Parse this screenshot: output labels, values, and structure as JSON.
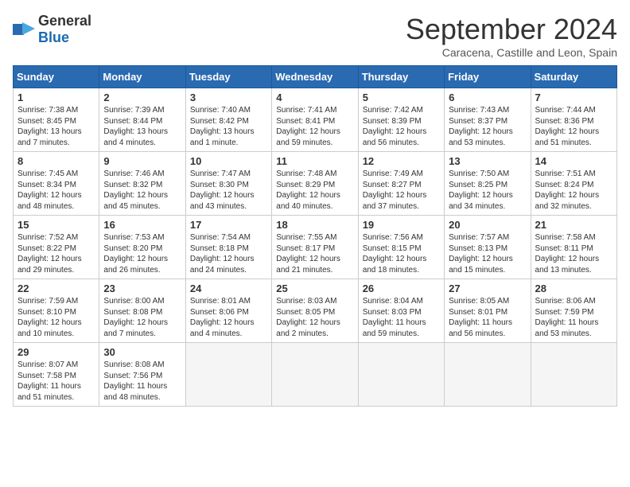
{
  "header": {
    "logo_general": "General",
    "logo_blue": "Blue",
    "title": "September 2024",
    "location": "Caracena, Castille and Leon, Spain"
  },
  "days_of_week": [
    "Sunday",
    "Monday",
    "Tuesday",
    "Wednesday",
    "Thursday",
    "Friday",
    "Saturday"
  ],
  "weeks": [
    [
      {
        "day": "1",
        "lines": [
          "Sunrise: 7:38 AM",
          "Sunset: 8:45 PM",
          "Daylight: 13 hours",
          "and 7 minutes."
        ]
      },
      {
        "day": "2",
        "lines": [
          "Sunrise: 7:39 AM",
          "Sunset: 8:44 PM",
          "Daylight: 13 hours",
          "and 4 minutes."
        ]
      },
      {
        "day": "3",
        "lines": [
          "Sunrise: 7:40 AM",
          "Sunset: 8:42 PM",
          "Daylight: 13 hours",
          "and 1 minute."
        ]
      },
      {
        "day": "4",
        "lines": [
          "Sunrise: 7:41 AM",
          "Sunset: 8:41 PM",
          "Daylight: 12 hours",
          "and 59 minutes."
        ]
      },
      {
        "day": "5",
        "lines": [
          "Sunrise: 7:42 AM",
          "Sunset: 8:39 PM",
          "Daylight: 12 hours",
          "and 56 minutes."
        ]
      },
      {
        "day": "6",
        "lines": [
          "Sunrise: 7:43 AM",
          "Sunset: 8:37 PM",
          "Daylight: 12 hours",
          "and 53 minutes."
        ]
      },
      {
        "day": "7",
        "lines": [
          "Sunrise: 7:44 AM",
          "Sunset: 8:36 PM",
          "Daylight: 12 hours",
          "and 51 minutes."
        ]
      }
    ],
    [
      {
        "day": "8",
        "lines": [
          "Sunrise: 7:45 AM",
          "Sunset: 8:34 PM",
          "Daylight: 12 hours",
          "and 48 minutes."
        ]
      },
      {
        "day": "9",
        "lines": [
          "Sunrise: 7:46 AM",
          "Sunset: 8:32 PM",
          "Daylight: 12 hours",
          "and 45 minutes."
        ]
      },
      {
        "day": "10",
        "lines": [
          "Sunrise: 7:47 AM",
          "Sunset: 8:30 PM",
          "Daylight: 12 hours",
          "and 43 minutes."
        ]
      },
      {
        "day": "11",
        "lines": [
          "Sunrise: 7:48 AM",
          "Sunset: 8:29 PM",
          "Daylight: 12 hours",
          "and 40 minutes."
        ]
      },
      {
        "day": "12",
        "lines": [
          "Sunrise: 7:49 AM",
          "Sunset: 8:27 PM",
          "Daylight: 12 hours",
          "and 37 minutes."
        ]
      },
      {
        "day": "13",
        "lines": [
          "Sunrise: 7:50 AM",
          "Sunset: 8:25 PM",
          "Daylight: 12 hours",
          "and 34 minutes."
        ]
      },
      {
        "day": "14",
        "lines": [
          "Sunrise: 7:51 AM",
          "Sunset: 8:24 PM",
          "Daylight: 12 hours",
          "and 32 minutes."
        ]
      }
    ],
    [
      {
        "day": "15",
        "lines": [
          "Sunrise: 7:52 AM",
          "Sunset: 8:22 PM",
          "Daylight: 12 hours",
          "and 29 minutes."
        ]
      },
      {
        "day": "16",
        "lines": [
          "Sunrise: 7:53 AM",
          "Sunset: 8:20 PM",
          "Daylight: 12 hours",
          "and 26 minutes."
        ]
      },
      {
        "day": "17",
        "lines": [
          "Sunrise: 7:54 AM",
          "Sunset: 8:18 PM",
          "Daylight: 12 hours",
          "and 24 minutes."
        ]
      },
      {
        "day": "18",
        "lines": [
          "Sunrise: 7:55 AM",
          "Sunset: 8:17 PM",
          "Daylight: 12 hours",
          "and 21 minutes."
        ]
      },
      {
        "day": "19",
        "lines": [
          "Sunrise: 7:56 AM",
          "Sunset: 8:15 PM",
          "Daylight: 12 hours",
          "and 18 minutes."
        ]
      },
      {
        "day": "20",
        "lines": [
          "Sunrise: 7:57 AM",
          "Sunset: 8:13 PM",
          "Daylight: 12 hours",
          "and 15 minutes."
        ]
      },
      {
        "day": "21",
        "lines": [
          "Sunrise: 7:58 AM",
          "Sunset: 8:11 PM",
          "Daylight: 12 hours",
          "and 13 minutes."
        ]
      }
    ],
    [
      {
        "day": "22",
        "lines": [
          "Sunrise: 7:59 AM",
          "Sunset: 8:10 PM",
          "Daylight: 12 hours",
          "and 10 minutes."
        ]
      },
      {
        "day": "23",
        "lines": [
          "Sunrise: 8:00 AM",
          "Sunset: 8:08 PM",
          "Daylight: 12 hours",
          "and 7 minutes."
        ]
      },
      {
        "day": "24",
        "lines": [
          "Sunrise: 8:01 AM",
          "Sunset: 8:06 PM",
          "Daylight: 12 hours",
          "and 4 minutes."
        ]
      },
      {
        "day": "25",
        "lines": [
          "Sunrise: 8:03 AM",
          "Sunset: 8:05 PM",
          "Daylight: 12 hours",
          "and 2 minutes."
        ]
      },
      {
        "day": "26",
        "lines": [
          "Sunrise: 8:04 AM",
          "Sunset: 8:03 PM",
          "Daylight: 11 hours",
          "and 59 minutes."
        ]
      },
      {
        "day": "27",
        "lines": [
          "Sunrise: 8:05 AM",
          "Sunset: 8:01 PM",
          "Daylight: 11 hours",
          "and 56 minutes."
        ]
      },
      {
        "day": "28",
        "lines": [
          "Sunrise: 8:06 AM",
          "Sunset: 7:59 PM",
          "Daylight: 11 hours",
          "and 53 minutes."
        ]
      }
    ],
    [
      {
        "day": "29",
        "lines": [
          "Sunrise: 8:07 AM",
          "Sunset: 7:58 PM",
          "Daylight: 11 hours",
          "and 51 minutes."
        ]
      },
      {
        "day": "30",
        "lines": [
          "Sunrise: 8:08 AM",
          "Sunset: 7:56 PM",
          "Daylight: 11 hours",
          "and 48 minutes."
        ]
      },
      {
        "day": "",
        "lines": []
      },
      {
        "day": "",
        "lines": []
      },
      {
        "day": "",
        "lines": []
      },
      {
        "day": "",
        "lines": []
      },
      {
        "day": "",
        "lines": []
      }
    ]
  ]
}
